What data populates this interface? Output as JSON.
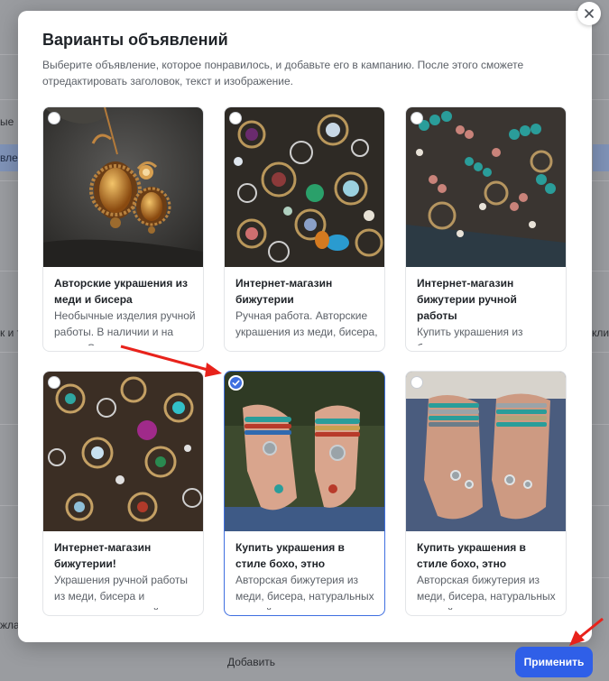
{
  "background": {
    "fragments": [
      "ые",
      "вле",
      "к и т",
      "жла",
      "кли"
    ],
    "add_label": "Добавить"
  },
  "modal": {
    "title": "Варианты объявлений",
    "description": "Выберите объявление, которое понравилось, и добавьте его в кампанию. После этого сможете отредактировать заголовок, текст и изображение.",
    "close_icon": "close-icon"
  },
  "cards": [
    {
      "title": "Авторские украшения из меди и бисера",
      "text": "Необычные изделия ручной работы. В наличии и на заказ. Оплата и",
      "selected": false,
      "image": "copper-amber-earrings"
    },
    {
      "title": "Интернет-магазин бижутерии",
      "text": "Ручная работа. Авторские украшения из меди, бисера, натуральных",
      "selected": false,
      "image": "pile-of-gemstone-jewelry"
    },
    {
      "title": "Интернет-магазин бижутерии ручной работы",
      "text": "Купить украшения из бисера, меди, натуральных камней. Необычные",
      "selected": false,
      "image": "turquoise-bead-jewelry"
    },
    {
      "title": "Интернет-магазин бижутерии!",
      "text": "Украшения ручной работы из меди, бисера и натуральных камней.",
      "selected": false,
      "image": "gemstone-rings-pile"
    },
    {
      "title": "Купить украшения в стиле бохо, этно",
      "text": "Авторская бижутерия из меди, бисера, натуральных камней.",
      "selected": true,
      "image": "boho-bracelets-hands"
    },
    {
      "title": "Купить украшения в стиле бохо, этно",
      "text": "Авторская бижутерия из меди, бисера, натуральных камней.",
      "selected": false,
      "image": "turquoise-bracelets-hands"
    }
  ],
  "apply_button": {
    "label": "Применить"
  },
  "colors": {
    "accent": "#2f5fe8",
    "selected_border": "#3f6fe0",
    "arrow": "#e8221b"
  }
}
